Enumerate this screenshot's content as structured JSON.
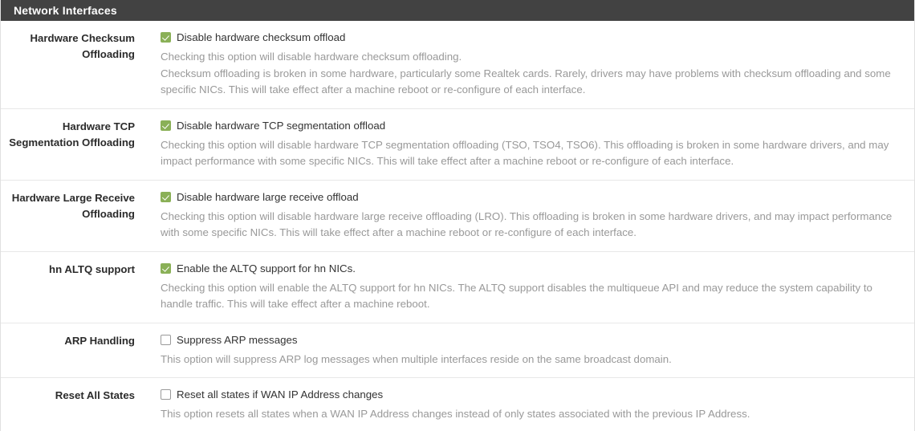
{
  "panel": {
    "title": "Network Interfaces"
  },
  "rows": [
    {
      "label": "Hardware Checksum Offloading",
      "checkbox_label": "Disable hardware checksum offload",
      "checked": true,
      "help_lines": [
        "Checking this option will disable hardware checksum offloading.",
        "Checksum offloading is broken in some hardware, particularly some Realtek cards. Rarely, drivers may have problems with checksum offloading and some specific NICs. This will take effect after a machine reboot or re-configure of each interface."
      ]
    },
    {
      "label": "Hardware TCP Segmentation Offloading",
      "checkbox_label": "Disable hardware TCP segmentation offload",
      "checked": true,
      "help_lines": [
        "Checking this option will disable hardware TCP segmentation offloading (TSO, TSO4, TSO6). This offloading is broken in some hardware drivers, and may impact performance with some specific NICs. This will take effect after a machine reboot or re-configure of each interface."
      ]
    },
    {
      "label": "Hardware Large Receive Offloading",
      "checkbox_label": "Disable hardware large receive offload",
      "checked": true,
      "help_lines": [
        "Checking this option will disable hardware large receive offloading (LRO). This offloading is broken in some hardware drivers, and may impact performance with some specific NICs. This will take effect after a machine reboot or re-configure of each interface."
      ]
    },
    {
      "label": "hn ALTQ support",
      "checkbox_label": "Enable the ALTQ support for hn NICs.",
      "checked": true,
      "help_lines": [
        "Checking this option will enable the ALTQ support for hn NICs. The ALTQ support disables the multiqueue API and may reduce the system capability to handle traffic. This will take effect after a machine reboot."
      ]
    },
    {
      "label": "ARP Handling",
      "checkbox_label": "Suppress ARP messages",
      "checked": false,
      "help_lines": [
        "This option will suppress ARP log messages when multiple interfaces reside on the same broadcast domain."
      ]
    },
    {
      "label": "Reset All States",
      "checkbox_label": "Reset all states if WAN IP Address changes",
      "checked": false,
      "help_lines": [
        "This option resets all states when a WAN IP Address changes instead of only states associated with the previous IP Address."
      ]
    }
  ],
  "colors": {
    "header_bg": "#424242",
    "checkbox_checked": "#8ab057",
    "label_text": "#2b2b2b",
    "help_text": "#999999"
  }
}
